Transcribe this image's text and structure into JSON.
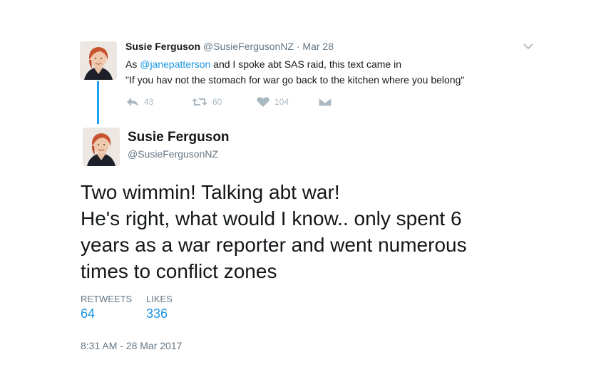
{
  "quoted": {
    "name": "Susie Ferguson",
    "handle": "@SusieFergusonNZ",
    "separator": "·",
    "date": "Mar 28",
    "text_prefix": "As ",
    "mention": "@janepatterson",
    "text_suffix": " and I spoke abt SAS raid, this text came in",
    "line2": "\"If you hav not the stomach for war go back to the kitchen where you belong\"",
    "actions": {
      "reply_count": "43",
      "retweet_count": "60",
      "like_count": "104"
    }
  },
  "main": {
    "name": "Susie Ferguson",
    "handle": "@SusieFergusonNZ",
    "text_lines": [
      "Two wimmin! Talking abt war!",
      "He's right, what would I know.. only spent 6",
      "years as a war reporter and went numerous",
      "times to conflict zones"
    ],
    "stats": {
      "retweets_label": "RETWEETS",
      "retweets_value": "64",
      "likes_label": "LIKES",
      "likes_value": "336"
    },
    "timestamp": "8:31 AM - 28 Mar 2017"
  },
  "colors": {
    "link": "#1b95e0",
    "muted": "#657786",
    "action": "#aab8c2",
    "thread_line": "#1da1f2"
  },
  "icons": [
    "chevron-down-icon",
    "reply-icon",
    "retweet-icon",
    "heart-icon",
    "direct-message-icon"
  ]
}
